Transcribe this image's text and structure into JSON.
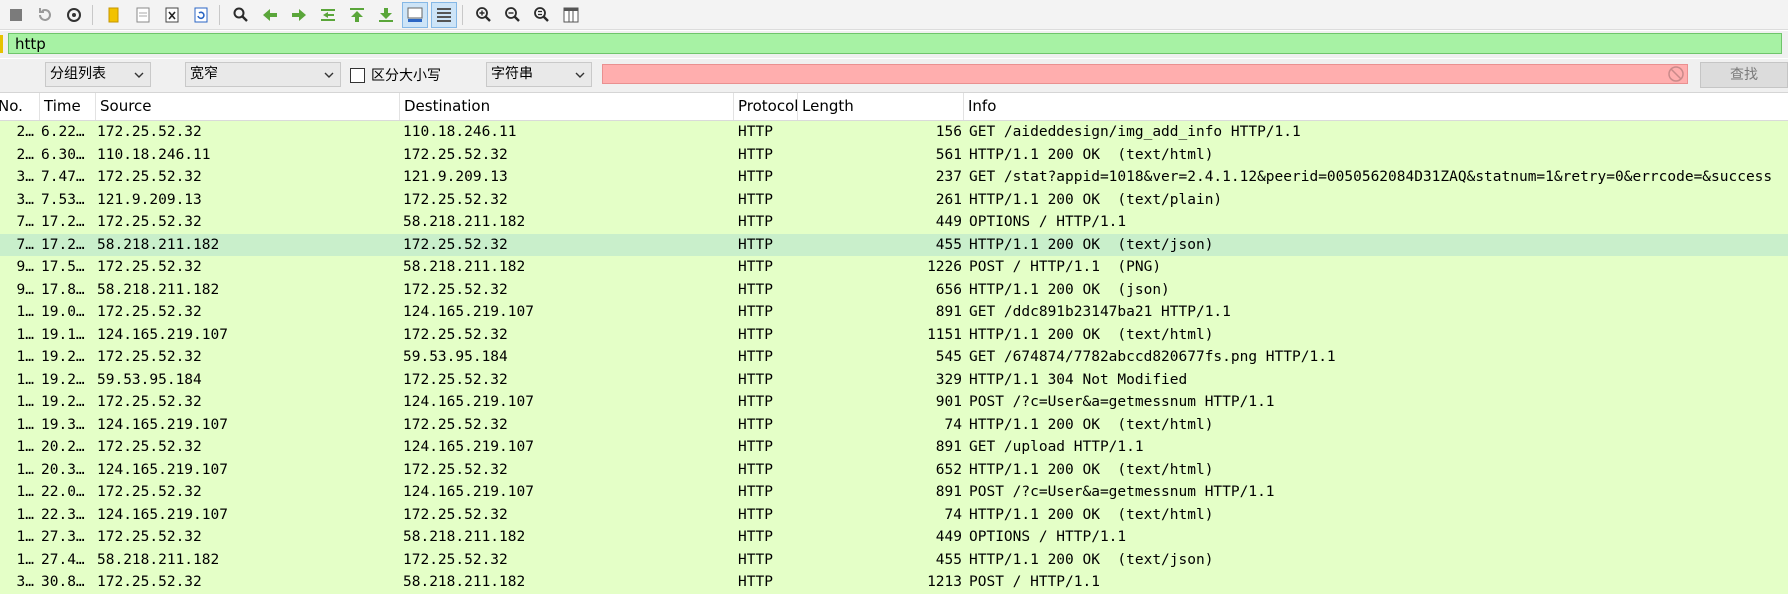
{
  "toolbar": {
    "buttons": [
      {
        "name": "stop-capture-icon"
      },
      {
        "name": "restart-capture-icon"
      },
      {
        "name": "capture-options-icon"
      },
      {
        "name": "open-file-icon"
      },
      {
        "name": "save-file-icon"
      },
      {
        "name": "close-file-icon"
      },
      {
        "name": "reload-file-icon"
      },
      {
        "name": "find-packet-icon"
      },
      {
        "name": "go-back-icon"
      },
      {
        "name": "go-forward-icon"
      },
      {
        "name": "go-to-packet-icon"
      },
      {
        "name": "go-first-packet-icon"
      },
      {
        "name": "go-last-packet-icon"
      },
      {
        "name": "auto-scroll-icon"
      },
      {
        "name": "colorize-icon"
      },
      {
        "name": "zoom-in-icon"
      },
      {
        "name": "zoom-out-icon"
      },
      {
        "name": "zoom-normal-icon"
      },
      {
        "name": "resize-columns-icon"
      }
    ]
  },
  "filter": {
    "value": "http"
  },
  "search": {
    "scope_select": "分组列表",
    "charset_select": "宽窄",
    "case_label": "区分大小写",
    "type_select": "字符串",
    "find_button": "查找"
  },
  "columns": {
    "no": "No.",
    "time": "Time",
    "source": "Source",
    "destination": "Destination",
    "protocol": "Protocol",
    "length": "Length",
    "info": "Info"
  },
  "packets": [
    {
      "no": "2…",
      "time": "6.22…",
      "src": "172.25.52.32",
      "dst": "110.18.246.11",
      "proto": "HTTP",
      "len": "156",
      "info": "GET /aideddesign/img_add_info HTTP/1.1"
    },
    {
      "no": "2…",
      "time": "6.30…",
      "src": "110.18.246.11",
      "dst": "172.25.52.32",
      "proto": "HTTP",
      "len": "561",
      "info": "HTTP/1.1 200 OK  (text/html)"
    },
    {
      "no": "3…",
      "time": "7.47…",
      "src": "172.25.52.32",
      "dst": "121.9.209.13",
      "proto": "HTTP",
      "len": "237",
      "info": "GET /stat?appid=1018&ver=2.4.1.12&peerid=0050562084D31ZAQ&statnum=1&retry=0&errcode=&success"
    },
    {
      "no": "3…",
      "time": "7.53…",
      "src": "121.9.209.13",
      "dst": "172.25.52.32",
      "proto": "HTTP",
      "len": "261",
      "info": "HTTP/1.1 200 OK  (text/plain)"
    },
    {
      "no": "7…",
      "time": "17.2…",
      "src": "172.25.52.32",
      "dst": "58.218.211.182",
      "proto": "HTTP",
      "len": "449",
      "info": "OPTIONS / HTTP/1.1"
    },
    {
      "no": "7…",
      "time": "17.2…",
      "src": "58.218.211.182",
      "dst": "172.25.52.32",
      "proto": "HTTP",
      "len": "455",
      "info": "HTTP/1.1 200 OK  (text/json)",
      "selected": true
    },
    {
      "no": "9…",
      "time": "17.5…",
      "src": "172.25.52.32",
      "dst": "58.218.211.182",
      "proto": "HTTP",
      "len": "1226",
      "info": "POST / HTTP/1.1  (PNG)"
    },
    {
      "no": "9…",
      "time": "17.8…",
      "src": "58.218.211.182",
      "dst": "172.25.52.32",
      "proto": "HTTP",
      "len": "656",
      "info": "HTTP/1.1 200 OK  (json)"
    },
    {
      "no": "1…",
      "time": "19.0…",
      "src": "172.25.52.32",
      "dst": "124.165.219.107",
      "proto": "HTTP",
      "len": "891",
      "info": "GET /ddc891b23147ba21 HTTP/1.1"
    },
    {
      "no": "1…",
      "time": "19.1…",
      "src": "124.165.219.107",
      "dst": "172.25.52.32",
      "proto": "HTTP",
      "len": "1151",
      "info": "HTTP/1.1 200 OK  (text/html)"
    },
    {
      "no": "1…",
      "time": "19.2…",
      "src": "172.25.52.32",
      "dst": "59.53.95.184",
      "proto": "HTTP",
      "len": "545",
      "info": "GET /674874/7782abccd820677fs.png HTTP/1.1"
    },
    {
      "no": "1…",
      "time": "19.2…",
      "src": "59.53.95.184",
      "dst": "172.25.52.32",
      "proto": "HTTP",
      "len": "329",
      "info": "HTTP/1.1 304 Not Modified"
    },
    {
      "no": "1…",
      "time": "19.2…",
      "src": "172.25.52.32",
      "dst": "124.165.219.107",
      "proto": "HTTP",
      "len": "901",
      "info": "POST /?c=User&a=getmessnum HTTP/1.1"
    },
    {
      "no": "1…",
      "time": "19.3…",
      "src": "124.165.219.107",
      "dst": "172.25.52.32",
      "proto": "HTTP",
      "len": "74",
      "info": "HTTP/1.1 200 OK  (text/html)"
    },
    {
      "no": "1…",
      "time": "20.2…",
      "src": "172.25.52.32",
      "dst": "124.165.219.107",
      "proto": "HTTP",
      "len": "891",
      "info": "GET /upload HTTP/1.1"
    },
    {
      "no": "1…",
      "time": "20.3…",
      "src": "124.165.219.107",
      "dst": "172.25.52.32",
      "proto": "HTTP",
      "len": "652",
      "info": "HTTP/1.1 200 OK  (text/html)"
    },
    {
      "no": "1…",
      "time": "22.0…",
      "src": "172.25.52.32",
      "dst": "124.165.219.107",
      "proto": "HTTP",
      "len": "891",
      "info": "POST /?c=User&a=getmessnum HTTP/1.1"
    },
    {
      "no": "1…",
      "time": "22.3…",
      "src": "124.165.219.107",
      "dst": "172.25.52.32",
      "proto": "HTTP",
      "len": "74",
      "info": "HTTP/1.1 200 OK  (text/html)"
    },
    {
      "no": "1…",
      "time": "27.3…",
      "src": "172.25.52.32",
      "dst": "58.218.211.182",
      "proto": "HTTP",
      "len": "449",
      "info": "OPTIONS / HTTP/1.1"
    },
    {
      "no": "1…",
      "time": "27.4…",
      "src": "58.218.211.182",
      "dst": "172.25.52.32",
      "proto": "HTTP",
      "len": "455",
      "info": "HTTP/1.1 200 OK  (text/json)"
    },
    {
      "no": "3…",
      "time": "30.8…",
      "src": "172.25.52.32",
      "dst": "58.218.211.182",
      "proto": "HTTP",
      "len": "1213",
      "info": "POST / HTTP/1.1"
    }
  ]
}
